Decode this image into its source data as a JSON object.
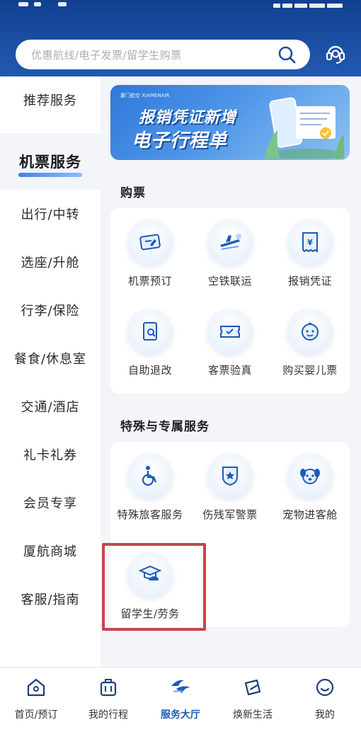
{
  "search": {
    "placeholder": "优惠航线/电子发票/留学生购票"
  },
  "sidebar": {
    "items": [
      {
        "label": "推荐服务"
      },
      {
        "label": "机票服务"
      },
      {
        "label": "出行/中转"
      },
      {
        "label": "选座/升舱"
      },
      {
        "label": "行李/保险"
      },
      {
        "label": "餐食/休息室"
      },
      {
        "label": "交通/酒店"
      },
      {
        "label": "礼卡礼券"
      },
      {
        "label": "会员专享"
      },
      {
        "label": "厦航商城"
      },
      {
        "label": "客服/指南"
      }
    ],
    "active_index": 1
  },
  "banner": {
    "brand": "厦门航空 XIAMENAIR",
    "line1": "报销凭证新增",
    "line2": "电子行程单"
  },
  "sections": [
    {
      "title": "购票",
      "services": [
        {
          "label": "机票预订",
          "icon": "ticket-booking-icon"
        },
        {
          "label": "空铁联运",
          "icon": "air-rail-icon"
        },
        {
          "label": "报销凭证",
          "icon": "receipt-icon"
        },
        {
          "label": "自助退改",
          "icon": "self-refund-icon"
        },
        {
          "label": "客票验真",
          "icon": "ticket-verify-icon"
        },
        {
          "label": "购买婴儿票",
          "icon": "baby-face-icon"
        }
      ]
    },
    {
      "title": "特殊与专属服务",
      "services": [
        {
          "label": "特殊旅客服务",
          "icon": "wheelchair-icon"
        },
        {
          "label": "伤残军警票",
          "icon": "military-badge-icon"
        },
        {
          "label": "宠物进客舱",
          "icon": "pet-dog-icon"
        },
        {
          "label": "留学生/劳务",
          "icon": "graduation-worker-icon"
        }
      ]
    }
  ],
  "bottom_nav": {
    "items": [
      {
        "label": "首页/预订",
        "icon": "home-icon"
      },
      {
        "label": "我的行程",
        "icon": "luggage-icon"
      },
      {
        "label": "服务大厅",
        "icon": "airline-logo-icon"
      },
      {
        "label": "焕新生活",
        "icon": "plane-ticket-icon"
      },
      {
        "label": "我的",
        "icon": "smile-face-icon"
      }
    ],
    "active_index": 2
  },
  "colors": {
    "header": "#1a4fa3",
    "accent": "#1c5bb8",
    "highlight_box": "#c8454d"
  }
}
